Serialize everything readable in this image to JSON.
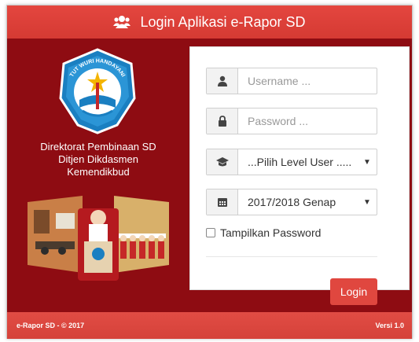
{
  "header": {
    "title": "Login Aplikasi e-Rapor SD",
    "icon": "users-icon"
  },
  "logo": {
    "motto": "TUT WURI HANDAYANI"
  },
  "department": {
    "line1": "Direktorat Pembinaan SD",
    "line2": "Ditjen Dikdasmen",
    "line3": "Kemendikbud"
  },
  "form": {
    "username": {
      "placeholder": "Username ...",
      "icon": "user-icon"
    },
    "password": {
      "placeholder": "Password ...",
      "icon": "lock-icon"
    },
    "level": {
      "value": "...Pilih Level User .....",
      "icon": "graduation-cap-icon"
    },
    "semester": {
      "value": "2017/2018 Genap",
      "icon": "calendar-icon"
    },
    "show_password": {
      "label": "Tampilkan Password",
      "checked": false
    },
    "login_label": "Login"
  },
  "footer": {
    "left": "e-Rapor SD - © 2017",
    "right": "Versi 1.0"
  },
  "colors": {
    "panel": "#8e0c12",
    "accent": "#e0473f",
    "logo_blue": "#1a7fc1"
  }
}
